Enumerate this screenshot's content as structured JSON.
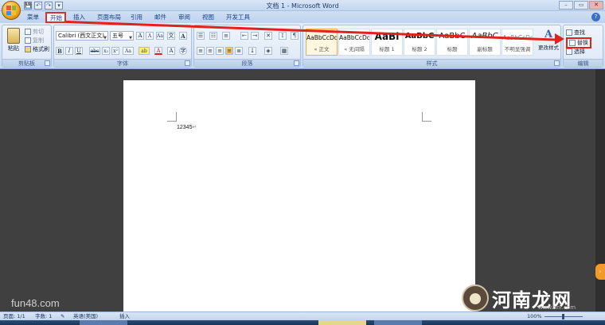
{
  "window": {
    "title": "文档 1 - Microsoft Word",
    "minimize": "–",
    "maximize": "▭",
    "close": "✕"
  },
  "quick_access": [
    "💾",
    "↶",
    "↷",
    "▾"
  ],
  "tabs": [
    "菜单",
    "开始",
    "插入",
    "页面布局",
    "引用",
    "邮件",
    "审阅",
    "视图",
    "开发工具"
  ],
  "active_tab": "开始",
  "clipboard": {
    "paste_label": "粘贴",
    "cut_label": "剪切",
    "copy_label": "复制",
    "format_painter_label": "格式刷",
    "group_label": "剪贴板"
  },
  "font": {
    "font_name": "Calibri (西文正文)",
    "font_size": "五号",
    "grow": "A",
    "shrink": "A",
    "clear": "Aa",
    "bold": "B",
    "italic": "I",
    "underline": "U",
    "strike": "abc",
    "subscript": "x₂",
    "superscript": "x²",
    "change_case": "Aa",
    "highlight": "ab",
    "font_color": "A",
    "group_label": "字体"
  },
  "paragraph": {
    "group_label": "段落"
  },
  "styles": {
    "group_label": "样式",
    "tiles": [
      {
        "preview": "AaBbCcDd",
        "name": "« 正文"
      },
      {
        "preview": "AaBbCcDd",
        "name": "« 无间隔"
      },
      {
        "preview": "AaBl",
        "name": "标题 1"
      },
      {
        "preview": "AaBbC",
        "name": "标题 2"
      },
      {
        "preview": "AaBbC",
        "name": "标题"
      },
      {
        "preview": "AaBbC",
        "name": "副标题"
      },
      {
        "preview": "AaBbCcDd",
        "name": "不明显强调"
      }
    ],
    "change_styles_label": "更改样式"
  },
  "editing": {
    "find_label": "查找",
    "replace_label": "替换",
    "select_label": "选择",
    "group_label": "编辑"
  },
  "document": {
    "text": "12345"
  },
  "watermarks": {
    "left": "fun48.com",
    "right": "河南龙网",
    "right_sub": "www.hnr.com"
  },
  "statusbar": {
    "page": "页面: 1/1",
    "words": "字数: 1",
    "language": "英语(美国)",
    "mode": "插入",
    "zoom": "100%"
  },
  "colors": {
    "highlight_red": "#e0211c",
    "ribbon": "#d4e3f5",
    "workspace": "#404040"
  }
}
